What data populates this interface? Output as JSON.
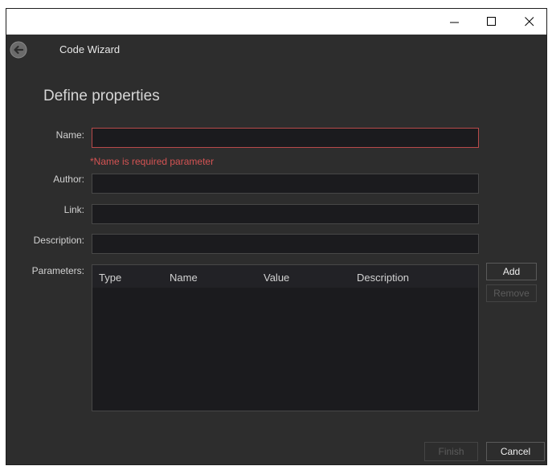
{
  "titlebar": {
    "minimize_icon": "minimize-icon",
    "maximize_icon": "maximize-icon",
    "close_icon": "close-icon"
  },
  "header": {
    "title": "Code Wizard",
    "back_icon": "back-arrow-circle-icon"
  },
  "page": {
    "section_title": "Define properties"
  },
  "form": {
    "name": {
      "label": "Name:",
      "value": "",
      "error": "*Name is required parameter"
    },
    "author": {
      "label": "Author:",
      "value": ""
    },
    "link": {
      "label": "Link:",
      "value": ""
    },
    "description": {
      "label": "Description:",
      "value": ""
    },
    "parameters": {
      "label": "Parameters:",
      "columns": [
        "Type",
        "Name",
        "Value",
        "Description"
      ],
      "rows": []
    }
  },
  "buttons": {
    "add": "Add",
    "remove": "Remove",
    "finish": "Finish",
    "cancel": "Cancel"
  },
  "colors": {
    "background": "#2d2d2d",
    "input_bg": "#1b1b1e",
    "error": "#d45353"
  }
}
